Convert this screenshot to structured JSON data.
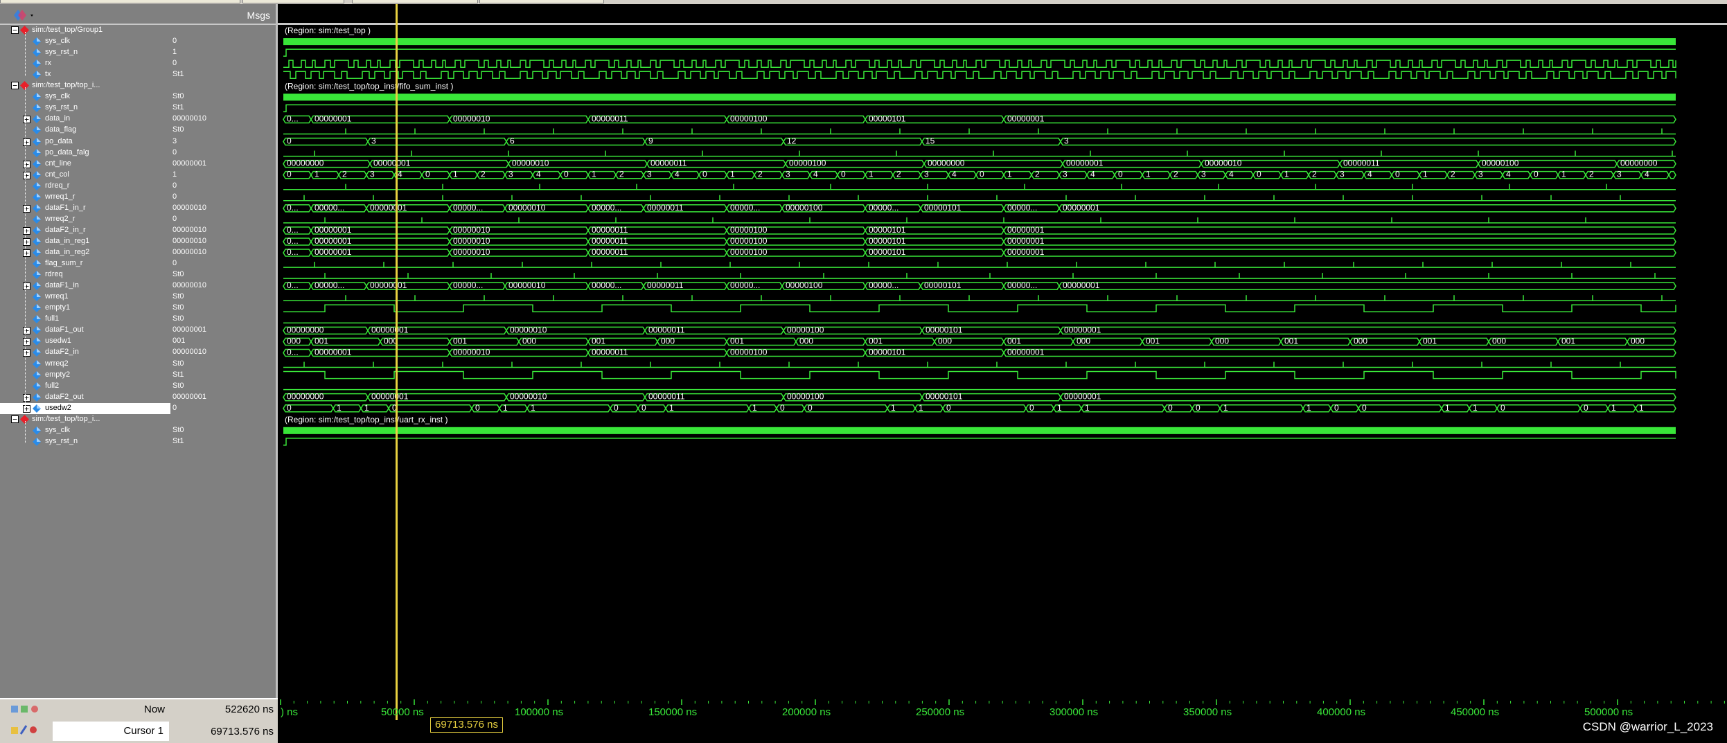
{
  "header": {
    "msgs_label": "Msgs"
  },
  "groups": [
    {
      "name": "sim:/test_top/Group1",
      "region": "(Region: sim:/test_top )"
    },
    {
      "name": "sim:/test_top/top_i...",
      "region": "(Region: sim:/test_top/top_inst/fifo_sum_inst )"
    },
    {
      "name": "sim:/test_top/top_i...",
      "region": "(Region: sim:/test_top/top_inst/uart_rx_inst )"
    }
  ],
  "signals": [
    {
      "name": "sim:/test_top/Group1",
      "value": "",
      "kind": "group"
    },
    {
      "name": "sys_clk",
      "value": "0",
      "kind": "clk"
    },
    {
      "name": "sys_rst_n",
      "value": "1",
      "kind": "bit"
    },
    {
      "name": "rx",
      "value": "0",
      "kind": "uart"
    },
    {
      "name": "tx",
      "value": "St1",
      "kind": "uart"
    },
    {
      "name": "sim:/test_top/top_i...",
      "value": "",
      "kind": "group"
    },
    {
      "name": "sys_clk",
      "value": "St0",
      "kind": "clk"
    },
    {
      "name": "sys_rst_n",
      "value": "St1",
      "kind": "bit"
    },
    {
      "name": "data_in",
      "value": "00000010",
      "kind": "bus",
      "expandable": true
    },
    {
      "name": "data_flag",
      "value": "St0",
      "kind": "pulse"
    },
    {
      "name": "po_data",
      "value": "3",
      "kind": "bus",
      "expandable": true
    },
    {
      "name": "po_data_falg",
      "value": "0",
      "kind": "pulse"
    },
    {
      "name": "cnt_line",
      "value": "00000001",
      "kind": "bus",
      "expandable": true
    },
    {
      "name": "cnt_col",
      "value": "1",
      "kind": "bus",
      "expandable": true
    },
    {
      "name": "rdreq_r",
      "value": "0",
      "kind": "pulse"
    },
    {
      "name": "wrreq1_r",
      "value": "0",
      "kind": "pulse"
    },
    {
      "name": "dataF1_in_r",
      "value": "00000010",
      "kind": "bus",
      "expandable": true
    },
    {
      "name": "wrreq2_r",
      "value": "0",
      "kind": "pulse"
    },
    {
      "name": "dataF2_in_r",
      "value": "00000010",
      "kind": "bus",
      "expandable": true
    },
    {
      "name": "data_in_reg1",
      "value": "00000010",
      "kind": "bus",
      "expandable": true
    },
    {
      "name": "data_in_reg2",
      "value": "00000010",
      "kind": "bus",
      "expandable": true
    },
    {
      "name": "flag_sum_r",
      "value": "0",
      "kind": "pulse"
    },
    {
      "name": "rdreq",
      "value": "St0",
      "kind": "pulse"
    },
    {
      "name": "dataF1_in",
      "value": "00000010",
      "kind": "bus",
      "expandable": true
    },
    {
      "name": "wrreq1",
      "value": "St0",
      "kind": "pulse"
    },
    {
      "name": "empty1",
      "value": "St0",
      "kind": "square"
    },
    {
      "name": "full1",
      "value": "St0",
      "kind": "low"
    },
    {
      "name": "dataF1_out",
      "value": "00000001",
      "kind": "bus",
      "expandable": true
    },
    {
      "name": "usedw1",
      "value": "001",
      "kind": "bus",
      "expandable": true
    },
    {
      "name": "dataF2_in",
      "value": "00000010",
      "kind": "bus",
      "expandable": true
    },
    {
      "name": "wrreq2",
      "value": "St0",
      "kind": "pulse"
    },
    {
      "name": "empty2",
      "value": "St1",
      "kind": "square"
    },
    {
      "name": "full2",
      "value": "St0",
      "kind": "low"
    },
    {
      "name": "dataF2_out",
      "value": "00000001",
      "kind": "bus",
      "expandable": true
    },
    {
      "name": "usedw2",
      "value": "0",
      "kind": "bus",
      "expandable": true,
      "selected": true
    },
    {
      "name": "sim:/test_top/top_i...",
      "value": "",
      "kind": "group"
    },
    {
      "name": "sys_clk",
      "value": "St0",
      "kind": "clk"
    },
    {
      "name": "sys_rst_n",
      "value": "St1",
      "kind": "bit"
    }
  ],
  "bus_labels": {
    "data_in": [
      "0...",
      "00000001",
      "00000010",
      "00000011",
      "00000100",
      "00000101",
      "00000001"
    ],
    "po_data": [
      "0",
      "3",
      "6",
      "9",
      "12",
      "15",
      "3"
    ],
    "cnt_line": [
      "00000000",
      "00000001",
      "00000010",
      "00000011",
      "00000100",
      "00000000",
      "00000001",
      "00000010",
      "00000011",
      "00000100"
    ],
    "cnt_col": [
      "0",
      "1",
      "2",
      "3",
      "4"
    ],
    "dataF1_in_r": [
      "0...",
      "00000...",
      "00000001",
      "00000...",
      "00000010",
      "00000...",
      "00000011",
      "00000...",
      "00000100",
      "00000...",
      "00000101",
      "00000...",
      "00000001"
    ],
    "dataF2_in_r": [
      "0...",
      "00000001",
      "00000010",
      "00000011",
      "00000100",
      "00000101",
      "00000001"
    ],
    "data_in_reg1": [
      "0...",
      "00000001",
      "00000010",
      "00000011",
      "00000100",
      "00000101",
      "00000001"
    ],
    "data_in_reg2": [
      "0...",
      "00000001",
      "00000010",
      "00000011",
      "00000100",
      "00000101",
      "00000001"
    ],
    "dataF1_in": [
      "0...",
      "00000...",
      "00000001",
      "00000...",
      "00000010",
      "00000...",
      "00000011",
      "00000...",
      "00000100",
      "00000...",
      "00000101",
      "00000...",
      "00000001"
    ],
    "dataF1_out": [
      "00000000",
      "00000001",
      "00000010",
      "00000011",
      "00000100",
      "00000101",
      "00000001"
    ],
    "usedw1": [
      "000",
      "001",
      "000",
      "001",
      "000",
      "001",
      "000",
      "001",
      "000",
      "001",
      "000",
      "001",
      "000",
      "001",
      "000",
      "001",
      "000",
      "001",
      "000",
      "001",
      "000"
    ],
    "dataF2_in": [
      "0...",
      "00000001",
      "00000010",
      "00000011",
      "00000100",
      "00000101",
      "00000001"
    ],
    "dataF2_out": [
      "00000000",
      "00000001",
      "00000010",
      "00000011",
      "00000100",
      "00000101",
      "00000001"
    ],
    "usedw2": [
      "0",
      "1",
      "1",
      "0"
    ]
  },
  "status": {
    "now_label": "Now",
    "now_value": "522620 ns",
    "cursor_label": "Cursor 1",
    "cursor_value": "69713.576 ns",
    "cursor_flag": "69713.576 ns"
  },
  "axis": {
    "ticks": [
      ") ns",
      "50000 ns",
      "100000 ns",
      "150000 ns",
      "200000 ns",
      "250000 ns",
      "300000 ns",
      "350000 ns",
      "400000 ns",
      "450000 ns",
      "500000 ns"
    ]
  },
  "watermark": "CSDN @warrior_L_2023",
  "colors": {
    "wave": "#39e639",
    "cursor": "#e8d040",
    "group": "#e8202a",
    "signal_icon": "#2a8be8"
  }
}
